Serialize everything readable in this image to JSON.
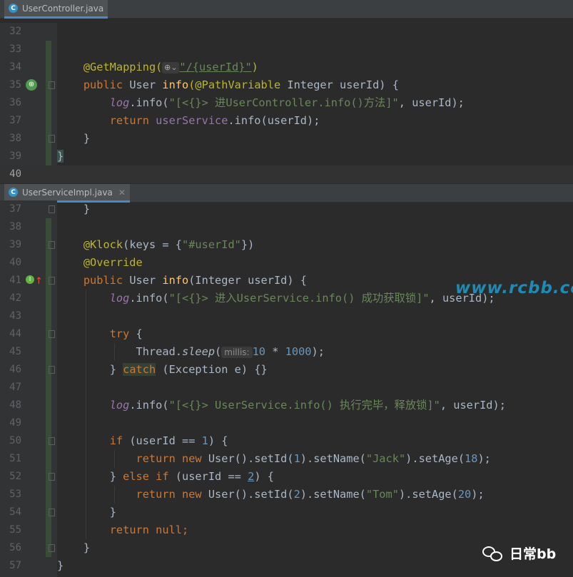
{
  "top_tab": {
    "name": "UserController.java",
    "icon": "class-icon"
  },
  "bottom_tab": {
    "name": "UserServiceImpl.java",
    "icon": "class-icon"
  },
  "top_lines": [
    "32",
    "33",
    "34",
    "35",
    "36",
    "37",
    "38",
    "39",
    "40"
  ],
  "bottom_lines": [
    "37",
    "38",
    "39",
    "40",
    "41",
    "42",
    "43",
    "44",
    "45",
    "46",
    "47",
    "48",
    "49",
    "50",
    "51",
    "52",
    "53",
    "54",
    "55",
    "56",
    "57"
  ],
  "code": {
    "c34_ann": "@GetMapping(",
    "c34_str": "\"/{userId}\"",
    "c34_end": ")",
    "c35_pub": "public",
    "c35_user": " User ",
    "c35_fn": "info",
    "c35_ann": "(@PathVariable",
    "c35_rest": " Integer userId) {",
    "c36_log": "log",
    "c36_info": ".info(",
    "c36_str": "\"[<{}> 进UserController.info()方法]\"",
    "c36_rest": ", userId);",
    "c37_ret": "return",
    "c37_svc": " userService",
    "c37_rest": ".info(userId);",
    "c38": "}",
    "c39": "}",
    "b37": "}",
    "b39_ann": "@Klock",
    "b39_mid": "(keys = {",
    "b39_str": "\"#userId\"",
    "b39_end": "})",
    "b40_ann": "@Override",
    "b41_pub": "public",
    "b41_user": " User ",
    "b41_fn": "info",
    "b41_rest": "(Integer userId) {",
    "b42_log": "log",
    "b42_info": ".info(",
    "b42_str": "\"[<{}> 进入UserService.info() 成功获取锁]\"",
    "b42_rest": ", userId);",
    "b44_try": "try",
    "b44_rest": " {",
    "b45_a": "Thread.",
    "b45_sleep": "sleep",
    "b45_b": "(",
    "b45_hint": "millis:",
    "b45_n1": "10",
    "b45_mid": " * ",
    "b45_n2": "1000",
    "b45_end": ");",
    "b46_brace": "} ",
    "b46_catch": "catch",
    "b46_rest": " (Exception e) {}",
    "b48_log": "log",
    "b48_info": ".info(",
    "b48_str": "\"[<{}> UserService.info() 执行完毕，释放锁]\"",
    "b48_rest": ", userId);",
    "b50_if": "if",
    "b50_a": " (userId == ",
    "b50_n": "1",
    "b50_b": ") {",
    "b51_ret": "return new",
    "b51_a": " User().setId(",
    "b51_n1": "1",
    "b51_b": ").setName(",
    "b51_str": "\"Jack\"",
    "b51_c": ").setAge(",
    "b51_n2": "18",
    "b51_d": ");",
    "b52_a": "} ",
    "b52_else": "else if",
    "b52_b": " (userId == ",
    "b52_n": "2",
    "b52_c": ") {",
    "b53_ret": "return new",
    "b53_a": " User().setId(",
    "b53_n1": "2",
    "b53_b": ").setName(",
    "b53_str": "\"Tom\"",
    "b53_c": ").setAge(",
    "b53_n2": "20",
    "b53_d": ");",
    "b54": "}",
    "b55_ret": "return null",
    "b55_end": ";",
    "b56": "}",
    "b57": "}"
  },
  "watermark_url": "www.rcbb.cc",
  "watermark_brand": "日常bb",
  "colors": {
    "keyword": "#cc7832",
    "annotation": "#bbb529",
    "string": "#6a8759",
    "field": "#9876aa",
    "function": "#ffc66d",
    "number": "#6897bb"
  }
}
